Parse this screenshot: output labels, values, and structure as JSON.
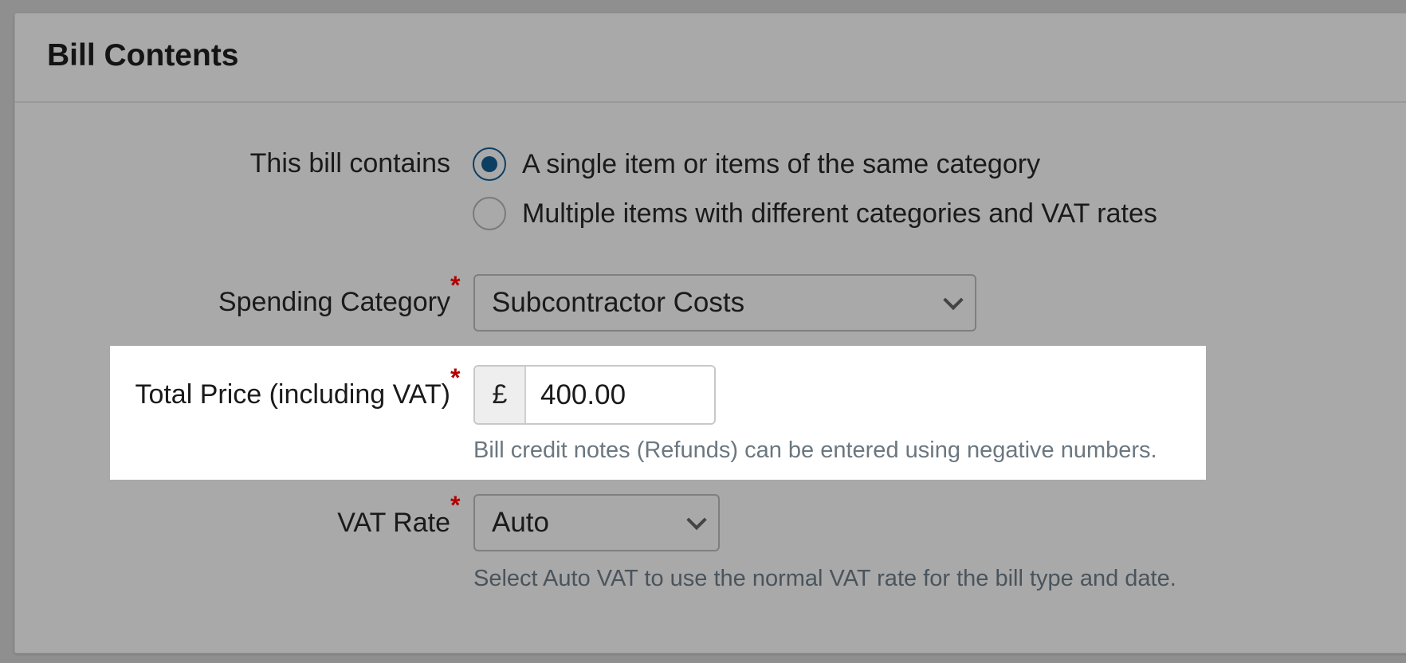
{
  "panel": {
    "title": "Bill Contents"
  },
  "bill_contains": {
    "label": "This bill contains",
    "options": [
      {
        "label": "A single item or items of the same category",
        "checked": true
      },
      {
        "label": "Multiple items with different categories and VAT rates",
        "checked": false
      }
    ]
  },
  "spending_category": {
    "label": "Spending Category",
    "required_mark": "*",
    "value": "Subcontractor Costs"
  },
  "total_price": {
    "label": "Total Price (including VAT)",
    "required_mark": "*",
    "currency_symbol": "£",
    "value": "400.00",
    "help": "Bill credit notes (Refunds) can be entered using negative numbers."
  },
  "vat_rate": {
    "label": "VAT Rate",
    "required_mark": "*",
    "value": "Auto",
    "help": "Select Auto VAT to use the normal VAT rate for the bill type and date."
  },
  "colors": {
    "overlay_background": "#a9a9a9",
    "highlight_background": "#ffffff",
    "required_star": "#b20000",
    "radio_selected": "#0d3f63",
    "help_text_dimmed": "#4a545c",
    "help_text_highlighted": "#6b7780"
  }
}
